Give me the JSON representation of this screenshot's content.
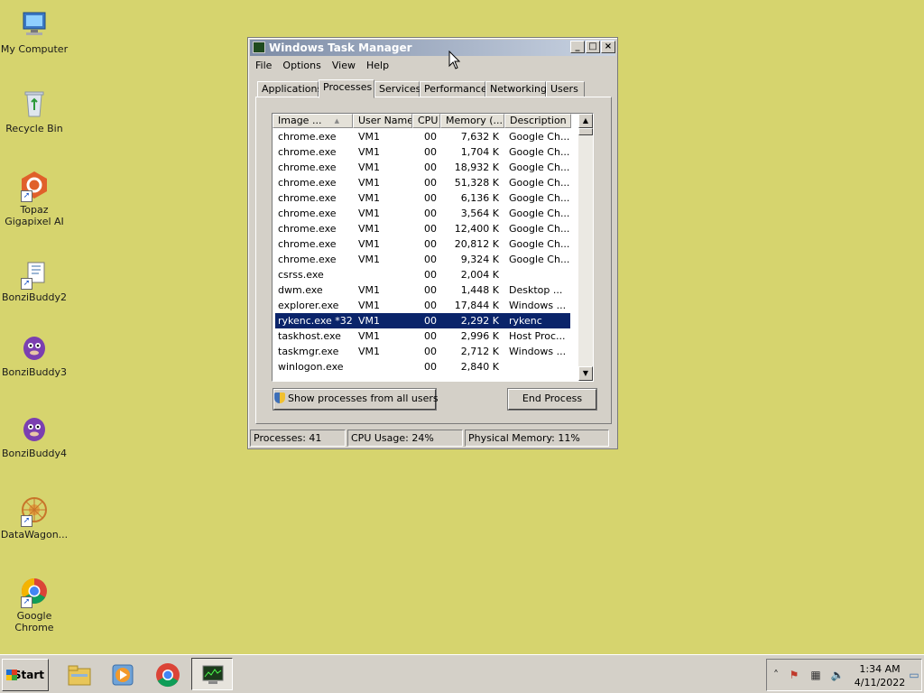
{
  "desktop": {
    "icons": [
      {
        "label": "My Computer",
        "icon": "computer-icon"
      },
      {
        "label": "Recycle Bin",
        "icon": "recycle-bin-icon"
      },
      {
        "label": "Topaz Gigapixel AI",
        "icon": "topaz-icon"
      },
      {
        "label": "BonziBuddy2",
        "icon": "bonzibuddy-file-icon"
      },
      {
        "label": "BonziBuddy3",
        "icon": "bonzibuddy-icon"
      },
      {
        "label": "BonziBuddy4",
        "icon": "bonzibuddy-icon"
      },
      {
        "label": "DataWagon...",
        "icon": "datawagon-icon"
      },
      {
        "label": "Google Chrome",
        "icon": "chrome-icon"
      }
    ]
  },
  "window": {
    "title": "Windows Task Manager",
    "menu": [
      "File",
      "Options",
      "View",
      "Help"
    ],
    "tabs": [
      "Applications",
      "Processes",
      "Services",
      "Performance",
      "Networking",
      "Users"
    ],
    "active_tab": "Processes",
    "columns": [
      "Image ...",
      "User Name",
      "CPU",
      "Memory (...",
      "Description"
    ],
    "processes": [
      {
        "image": "chrome.exe",
        "user": "VM1",
        "cpu": "00",
        "memory": "7,632 K",
        "description": "Google Ch..."
      },
      {
        "image": "chrome.exe",
        "user": "VM1",
        "cpu": "00",
        "memory": "1,704 K",
        "description": "Google Ch..."
      },
      {
        "image": "chrome.exe",
        "user": "VM1",
        "cpu": "00",
        "memory": "18,932 K",
        "description": "Google Ch..."
      },
      {
        "image": "chrome.exe",
        "user": "VM1",
        "cpu": "00",
        "memory": "51,328 K",
        "description": "Google Ch..."
      },
      {
        "image": "chrome.exe",
        "user": "VM1",
        "cpu": "00",
        "memory": "6,136 K",
        "description": "Google Ch..."
      },
      {
        "image": "chrome.exe",
        "user": "VM1",
        "cpu": "00",
        "memory": "3,564 K",
        "description": "Google Ch..."
      },
      {
        "image": "chrome.exe",
        "user": "VM1",
        "cpu": "00",
        "memory": "12,400 K",
        "description": "Google Ch..."
      },
      {
        "image": "chrome.exe",
        "user": "VM1",
        "cpu": "00",
        "memory": "20,812 K",
        "description": "Google Ch..."
      },
      {
        "image": "chrome.exe",
        "user": "VM1",
        "cpu": "00",
        "memory": "9,324 K",
        "description": "Google Ch..."
      },
      {
        "image": "csrss.exe",
        "user": "",
        "cpu": "00",
        "memory": "2,004 K",
        "description": ""
      },
      {
        "image": "dwm.exe",
        "user": "VM1",
        "cpu": "00",
        "memory": "1,448 K",
        "description": "Desktop ..."
      },
      {
        "image": "explorer.exe",
        "user": "VM1",
        "cpu": "00",
        "memory": "17,844 K",
        "description": "Windows ..."
      },
      {
        "image": "rykenc.exe *32",
        "user": "VM1",
        "cpu": "00",
        "memory": "2,292 K",
        "description": "rykenc",
        "selected": true
      },
      {
        "image": "taskhost.exe",
        "user": "VM1",
        "cpu": "00",
        "memory": "2,996 K",
        "description": "Host Proc..."
      },
      {
        "image": "taskmgr.exe",
        "user": "VM1",
        "cpu": "00",
        "memory": "2,712 K",
        "description": "Windows ..."
      },
      {
        "image": "winlogon.exe",
        "user": "",
        "cpu": "00",
        "memory": "2,840 K",
        "description": ""
      }
    ],
    "show_all_button": "Show processes from all users",
    "end_process_button": "End Process",
    "status": {
      "processes": "Processes: 41",
      "cpu": "CPU Usage: 24%",
      "memory": "Physical Memory: 11%"
    }
  },
  "taskbar": {
    "start_label": "Start",
    "apps": [
      "explorer-icon",
      "media-player-icon",
      "chrome-icon",
      "task-manager-icon"
    ],
    "clock_time": "1:34 AM",
    "clock_date": "4/11/2022"
  },
  "colors": {
    "desktop": "#d6d46e",
    "selection": "#0a246a",
    "window_face": "#d4d0c8"
  }
}
